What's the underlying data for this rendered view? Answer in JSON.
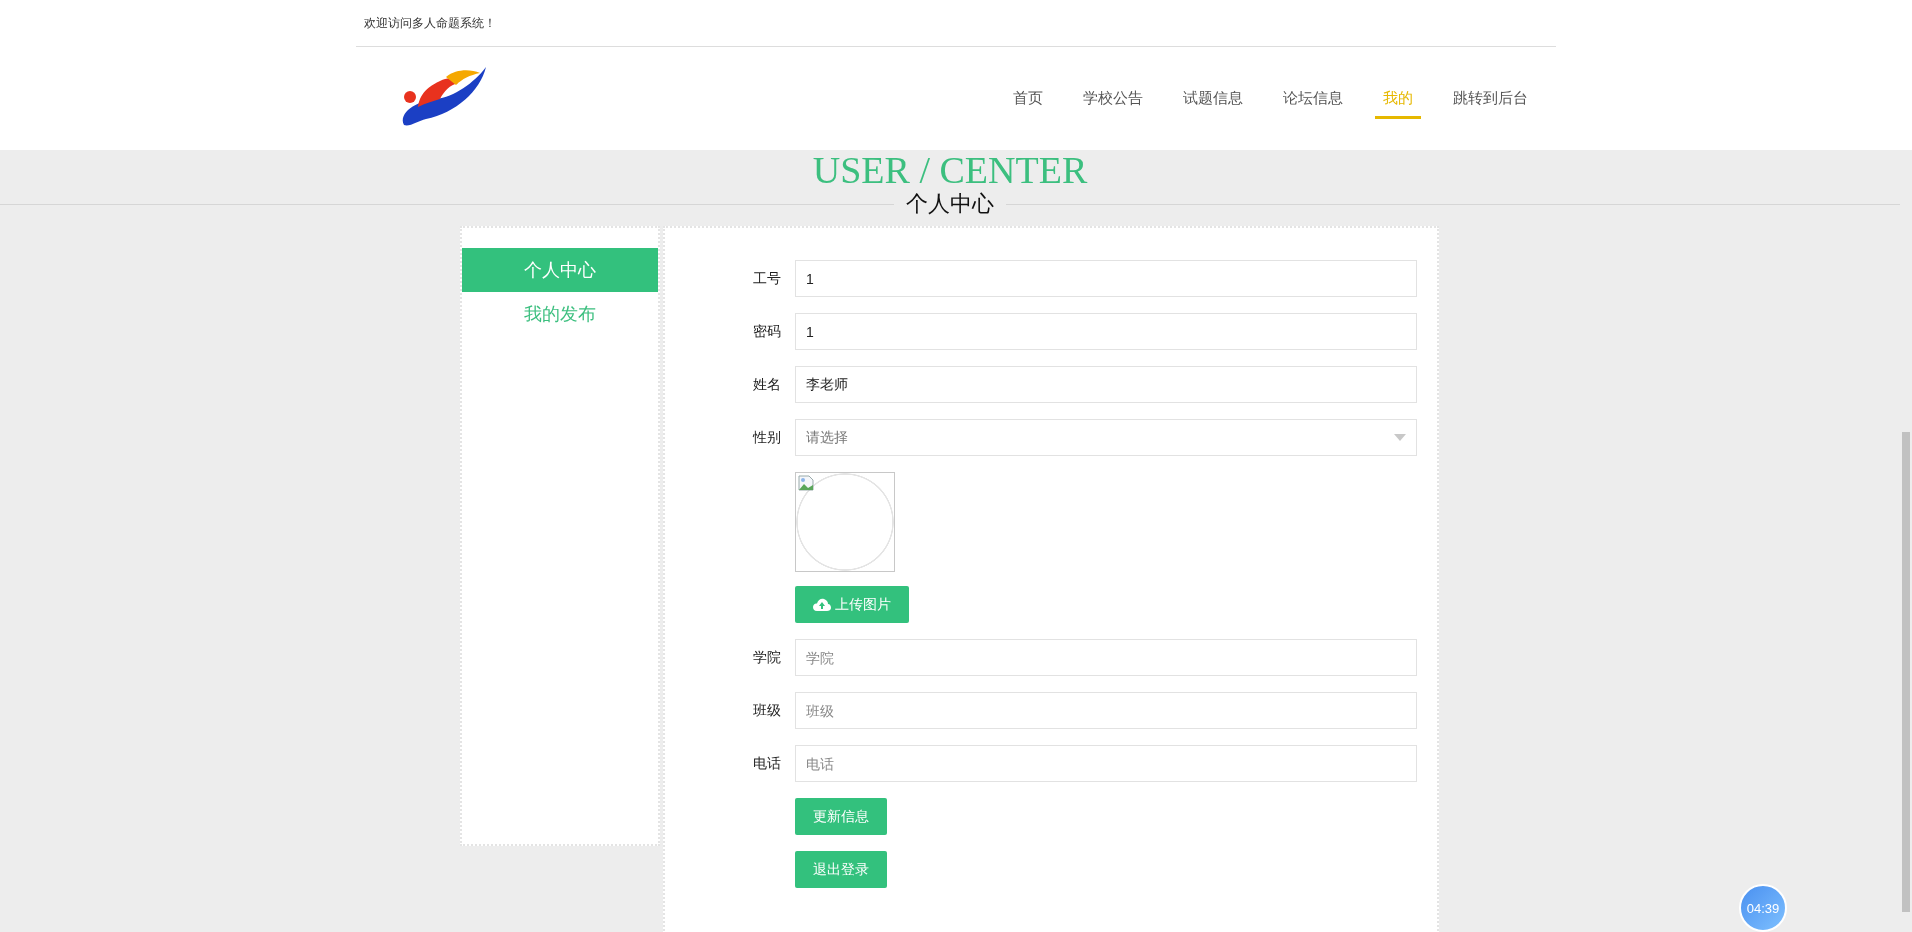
{
  "top_bar": {
    "welcome": "欢迎访问多人命题系统！"
  },
  "nav": [
    {
      "label": "首页",
      "selected": false
    },
    {
      "label": "学校公告",
      "selected": false
    },
    {
      "label": "试题信息",
      "selected": false
    },
    {
      "label": "论坛信息",
      "selected": false
    },
    {
      "label": "我的",
      "selected": true
    },
    {
      "label": "跳转到后台",
      "selected": false
    }
  ],
  "page_title": {
    "english": "USER / CENTER",
    "chinese": "个人中心"
  },
  "sidebar": {
    "items": [
      {
        "label": "个人中心",
        "selected": true
      },
      {
        "label": "我的发布",
        "selected": false
      }
    ]
  },
  "form": {
    "fields": [
      {
        "kind": "input",
        "label": "工号",
        "value": "1"
      },
      {
        "kind": "input",
        "label": "密码",
        "value": "1"
      },
      {
        "kind": "input",
        "label": "姓名",
        "value": "李老师"
      },
      {
        "kind": "select",
        "label": "性别",
        "placeholder": "请选择"
      },
      {
        "kind": "image",
        "button": "上传图片"
      },
      {
        "kind": "input",
        "label": "学院",
        "placeholder": "学院"
      },
      {
        "kind": "input",
        "label": "班级",
        "placeholder": "班级"
      },
      {
        "kind": "input",
        "label": "电话",
        "placeholder": "电话"
      }
    ],
    "buttons": [
      "更新信息",
      "退出登录"
    ]
  },
  "timer": "04:39"
}
